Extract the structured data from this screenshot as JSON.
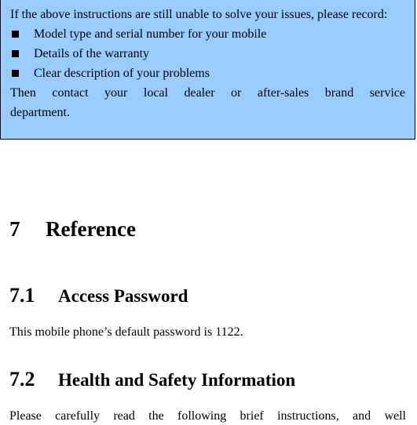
{
  "note": {
    "intro": "If the above instructions are still unable to solve your issues, please record:",
    "items": [
      "Model type and serial number for your mobile",
      "Details of the warranty",
      "Clear description of your problems"
    ],
    "closing_line1": "Then contact your local dealer or after-sales brand service",
    "closing_line2": "department.",
    "background_color": "#99ccff"
  },
  "section7": {
    "number": "7",
    "title": "Reference"
  },
  "section7_1": {
    "number": "7.1",
    "title": "Access Password",
    "body": "This mobile phone’s default password is 1122."
  },
  "section7_2": {
    "number": "7.2",
    "title": "Health and Safety Information",
    "body": "Please carefully read the following brief instructions, and well"
  }
}
